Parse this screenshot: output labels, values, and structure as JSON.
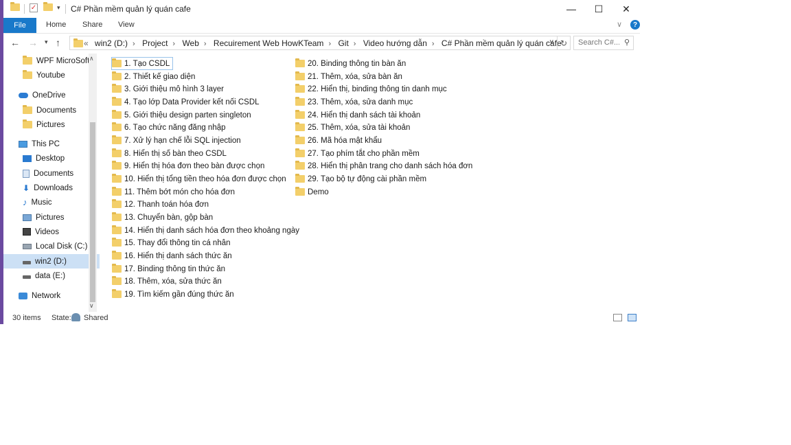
{
  "window": {
    "title": "C# Phần mềm quản lý quán cafe",
    "controls": [
      "—",
      "☐",
      "✕"
    ]
  },
  "ribbon": {
    "file": "File",
    "tabs": [
      "Home",
      "Share",
      "View"
    ],
    "help": "?",
    "accent": "#1979ca"
  },
  "address": {
    "overflow": "«",
    "crumbs": [
      "win2 (D:)",
      "Project",
      "Web",
      "Recuirement Web HowKTeam",
      "Git",
      "Video hướng dẫn",
      "C# Phần mềm quản lý quán cafe"
    ],
    "search_placeholder": "Search C#..."
  },
  "sidebar": {
    "items": [
      {
        "label": "WPF MicroSoft",
        "icon": "folder-icon",
        "indent": 1
      },
      {
        "label": "Youtube",
        "icon": "folder-icon",
        "indent": 1
      },
      {
        "label": "OneDrive",
        "icon": "onedrive-icon",
        "indent": 0
      },
      {
        "label": "Documents",
        "icon": "folder-icon",
        "indent": 1
      },
      {
        "label": "Pictures",
        "icon": "folder-icon",
        "indent": 1
      },
      {
        "label": "This PC",
        "icon": "computer-icon",
        "indent": 0
      },
      {
        "label": "Desktop",
        "icon": "desktop-icon",
        "indent": 1
      },
      {
        "label": "Documents",
        "icon": "documents-icon",
        "indent": 1
      },
      {
        "label": "Downloads",
        "icon": "downloads-icon",
        "indent": 1
      },
      {
        "label": "Music",
        "icon": "music-icon",
        "indent": 1
      },
      {
        "label": "Pictures",
        "icon": "pictures-icon",
        "indent": 1
      },
      {
        "label": "Videos",
        "icon": "videos-icon",
        "indent": 1
      },
      {
        "label": "Local Disk (C:)",
        "icon": "local-disk-icon",
        "indent": 1
      },
      {
        "label": "win2 (D:)",
        "icon": "drive-icon",
        "indent": 1,
        "selected": true
      },
      {
        "label": "data (E:)",
        "icon": "drive-icon",
        "indent": 1
      },
      {
        "label": "Network",
        "icon": "network-icon",
        "indent": 0
      }
    ]
  },
  "files": {
    "col1": [
      "1. Tạo CSDL",
      "2. Thiết kế giao diện",
      "3. Giới thiệu mô hình 3 layer",
      "4. Tạo lớp Data Provider kết nối CSDL",
      "5. Giới thiệu design parten singleton",
      "6. Tạo chức năng đăng nhập",
      "7. Xử lý hạn chế lỗi SQL injection",
      "8. Hiển thị số bàn theo CSDL",
      "9. Hiển thị hóa đơn theo bàn được chọn",
      "10. Hiển thị tổng tiền theo hóa đơn được chọn",
      "11. Thêm bớt món cho hóa đơn",
      "12. Thanh toán hóa đơn",
      "13. Chuyển bàn, gộp bàn",
      "14. Hiển thị danh sách hóa đơn theo khoảng ngày",
      "15. Thay đổi thông tin cá nhân",
      "16. Hiển thị danh sách thức ăn",
      "17. Binding thông tin thức ăn",
      "18. Thêm, xóa, sửa thức ăn",
      "19. Tìm kiếm gần đúng thức ăn"
    ],
    "col2": [
      "20. Binding thông tin bàn ăn",
      "21. Thêm, xóa, sửa bàn ăn",
      "22. Hiển thị, binding thông tin danh mục",
      "23. Thêm, xóa, sửa danh mục",
      "24. Hiển thị danh sách tài khoản",
      "25. Thêm, xóa, sửa tài khoản",
      "26. Mã hóa mật khẩu",
      "27. Tạo phím tắt cho phần mềm",
      "28. Hiển thị phân trang cho danh sách hóa đơn",
      "29. Tạo bộ tự động cài phần mềm",
      "Demo"
    ]
  },
  "status": {
    "count": "30 items",
    "state_label": "State:",
    "state_value": "Shared"
  }
}
